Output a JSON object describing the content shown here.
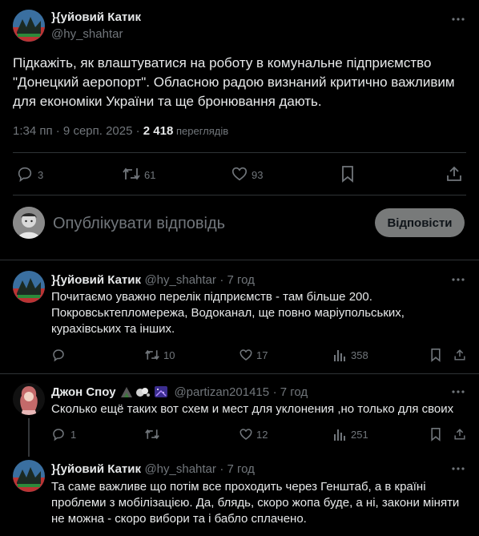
{
  "main_tweet": {
    "author_name": "}{уйовий Катик",
    "author_handle": "@hy_shahtar",
    "text_lines": [
      "Підкажіть, як влаштуватися на роботу в комунальне підприємство",
      "\"Донецкий аеропорт\". Обласною радою визнаний критично важливим",
      "для економіки України та ще бронювання дають."
    ],
    "time": "1:34 пп · 9 серп. 2025 · ",
    "views_count": "2 418",
    "views_label": "переглядів",
    "replies": "3",
    "retweets": "61",
    "likes": "93"
  },
  "reply_box": {
    "placeholder": "Опублікувати відповідь",
    "button_label": "Відповісти"
  },
  "replies": [
    {
      "author_name": "}{уйовий Катик",
      "author_handle": "@hy_shahtar",
      "time": "· 7 год",
      "text_lines": [
        "Почитаємо уважно перелік підприємств - там більше 200.",
        "Покровськтепломережа, Водоканал, ще повно маріупольських,",
        "курахівських та інших."
      ],
      "replies": "",
      "retweets": "10",
      "likes": "17",
      "views": "358"
    },
    {
      "author_name": "Джон Споу",
      "author_handle": "@partizan201415",
      "time": "· 7 год",
      "text_lines": [
        "Сколько ещё таких вот схем и мест для уклонения ,но только для своих"
      ],
      "replies": "1",
      "retweets": "",
      "likes": "12",
      "views": "251"
    },
    {
      "author_name": "}{уйовий Катик",
      "author_handle": "@hy_shahtar",
      "time": "· 7 год",
      "text_lines": [
        "Та саме важливе що потім все проходить через Генштаб,  а в країні",
        "проблеми з мобілізацією. Да, блядь, скоро жопа буде, а ні, закони міняти",
        "не можна - скоро вибори та і бабло сплачено."
      ]
    }
  ],
  "colors": {
    "background": "#000000",
    "text": "#e7e9ea",
    "muted": "#71767b",
    "divider": "#2f3336",
    "button_bg": "#787a7a"
  },
  "icons": [
    "more-icon",
    "reply-icon",
    "retweet-icon",
    "like-icon",
    "bookmark-icon",
    "share-icon",
    "views-icon"
  ]
}
